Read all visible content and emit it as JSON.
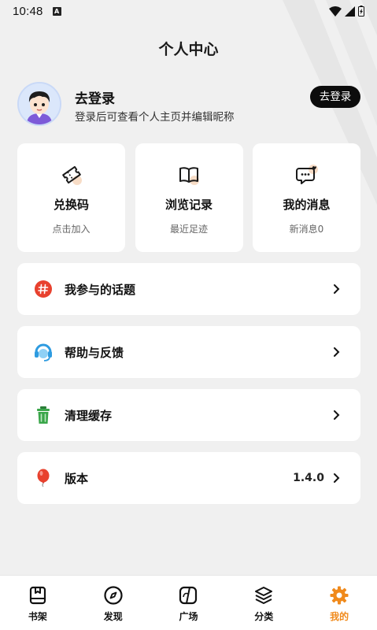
{
  "status_bar": {
    "time": "10:48",
    "notification_letter": "A"
  },
  "header": {
    "title": "个人中心"
  },
  "profile": {
    "name": "去登录",
    "subtitle": "登录后可查看个人主页并编辑昵称",
    "login_button": "去登录"
  },
  "cards": [
    {
      "title": "兑换码",
      "sub": "点击加入",
      "icon": "ticket-icon"
    },
    {
      "title": "浏览记录",
      "sub": "最近足迹",
      "icon": "book-icon"
    },
    {
      "title": "我的消息",
      "sub": "新消息0",
      "icon": "message-icon"
    }
  ],
  "menu": [
    {
      "label": "我参与的话题",
      "icon": "hashtag-icon",
      "value": ""
    },
    {
      "label": "帮助与反馈",
      "icon": "help-icon",
      "value": ""
    },
    {
      "label": "清理缓存",
      "icon": "trash-icon",
      "value": ""
    },
    {
      "label": "版本",
      "icon": "balloon-icon",
      "value": "1.4.0"
    }
  ],
  "tabs": [
    {
      "label": "书架",
      "icon": "bookshelf-icon",
      "active": false
    },
    {
      "label": "发现",
      "icon": "compass-icon",
      "active": false
    },
    {
      "label": "广场",
      "icon": "square-icon",
      "active": false
    },
    {
      "label": "分类",
      "icon": "layers-icon",
      "active": false
    },
    {
      "label": "我的",
      "icon": "gear-icon",
      "active": true
    }
  ],
  "colors": {
    "accent": "#f08a1c",
    "background": "#f0f0f0",
    "button_dark": "#0c0c0c",
    "hashtag_red": "#e8412e",
    "help_blue": "#2e9be0",
    "trash_green": "#3aa64a"
  }
}
